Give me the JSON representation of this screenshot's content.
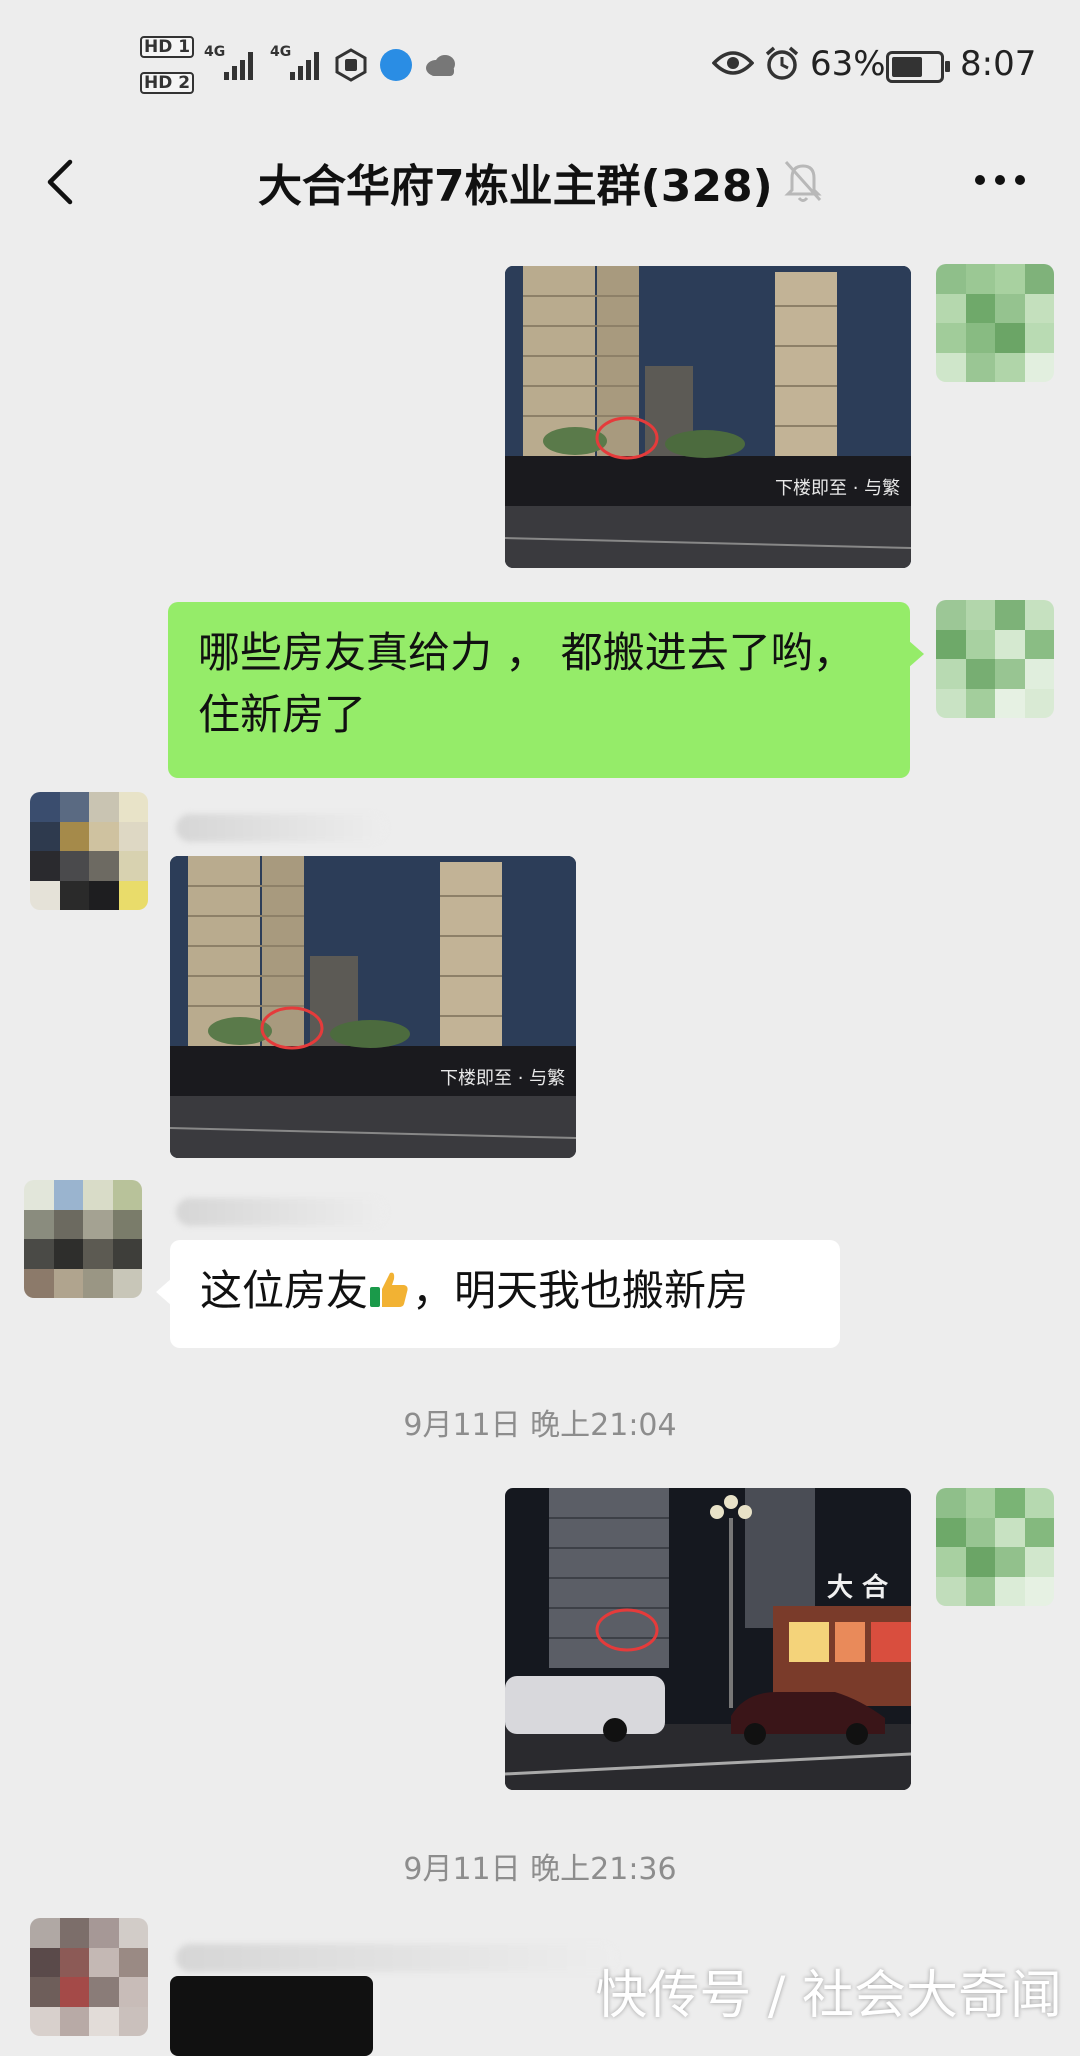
{
  "status_bar": {
    "sim1_label": "HD 1",
    "sim2_label": "HD 2",
    "net1": "4G",
    "net2": "4G",
    "battery_percent": "63%",
    "time": "8:07",
    "icons": [
      "eye-icon",
      "alarm-icon",
      "battery-icon",
      "cloud-icon",
      "globe-icon",
      "hand-icon"
    ]
  },
  "header": {
    "title": "大合华府7栋业主群(328)",
    "back_icon": "chevron-left-icon",
    "mute_icon": "bell-muted-icon",
    "more_icon": "more-dots-icon"
  },
  "messages": [
    {
      "side": "right",
      "type": "image",
      "image_alt": "buildings-night-photo-circled"
    },
    {
      "side": "right",
      "type": "text",
      "text": "哪些房友真给力 ，  都搬进去了哟，住新房了"
    },
    {
      "side": "left",
      "type": "image",
      "image_alt": "buildings-night-photo-circled"
    },
    {
      "side": "left",
      "type": "text",
      "text_before": "这位房友",
      "text_after": "，明天我也搬新房",
      "emoji": "thumbs-up-emoji"
    },
    {
      "side": "right",
      "type": "image",
      "image_alt": "street-night-photo-circled"
    }
  ],
  "timestamps": [
    "9月11日 晚上21:04",
    "9月11日 晚上21:36"
  ],
  "photo_signs": {
    "sign1": "下楼即至 · 与繁",
    "sign2": "大 合"
  },
  "watermark": "快传号 / 社会大奇闻",
  "colors": {
    "background": "#ededed",
    "green_bubble": "#95ec69",
    "white_bubble": "#ffffff",
    "timestamp": "#8d8d8d"
  }
}
